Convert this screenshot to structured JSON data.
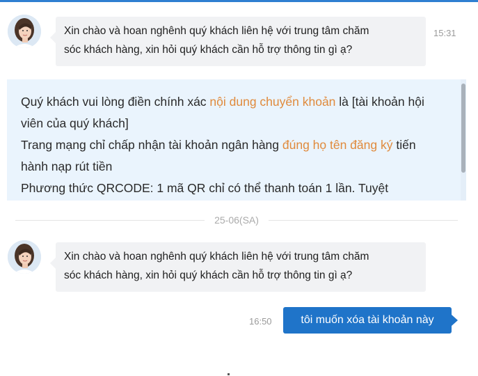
{
  "messages": [
    {
      "sender": "agent",
      "avatar_icon": "agent-avatar-icon",
      "lines": [
        "Xin chào và hoan nghênh quý khách liên hệ với trung tâm chăm",
        "sóc khách hàng, xin hỏi quý khách cần hỗ trợ thông tin gì ạ?"
      ],
      "time": "15:31"
    },
    {
      "sender": "agent",
      "avatar_icon": "agent-avatar-icon",
      "lines": [
        "Xin chào và hoan nghênh quý khách liên hệ với trung tâm chăm",
        "sóc khách hàng, xin hỏi quý khách cần hỗ trợ thông tin gì ạ?"
      ]
    },
    {
      "sender": "user",
      "text": "tôi muốn xóa tài khoản này",
      "time": "16:50"
    }
  ],
  "notice": {
    "p1_a": "Quý khách vui lòng điền chính xác ",
    "p1_hl": "nội dung chuyển khoản",
    "p1_b": " là [tài khoản hội viên của quý khách]",
    "p2_a": "Trang mạng chỉ chấp nhận tài khoản ngân hàng ",
    "p2_hl": "đúng họ tên đăng ký",
    "p2_b": " tiến hành nạp rút tiền",
    "p3": "Phương thức QRCODE: 1 mã QR chỉ có thể thanh toán 1 lần. Tuyệt"
  },
  "date_divider": "25-06(SA)",
  "colors": {
    "accent": "#1f74c9",
    "highlight": "#e08a3c",
    "notice_bg": "#eaf4fd",
    "bubble_bg": "#f1f2f4"
  }
}
